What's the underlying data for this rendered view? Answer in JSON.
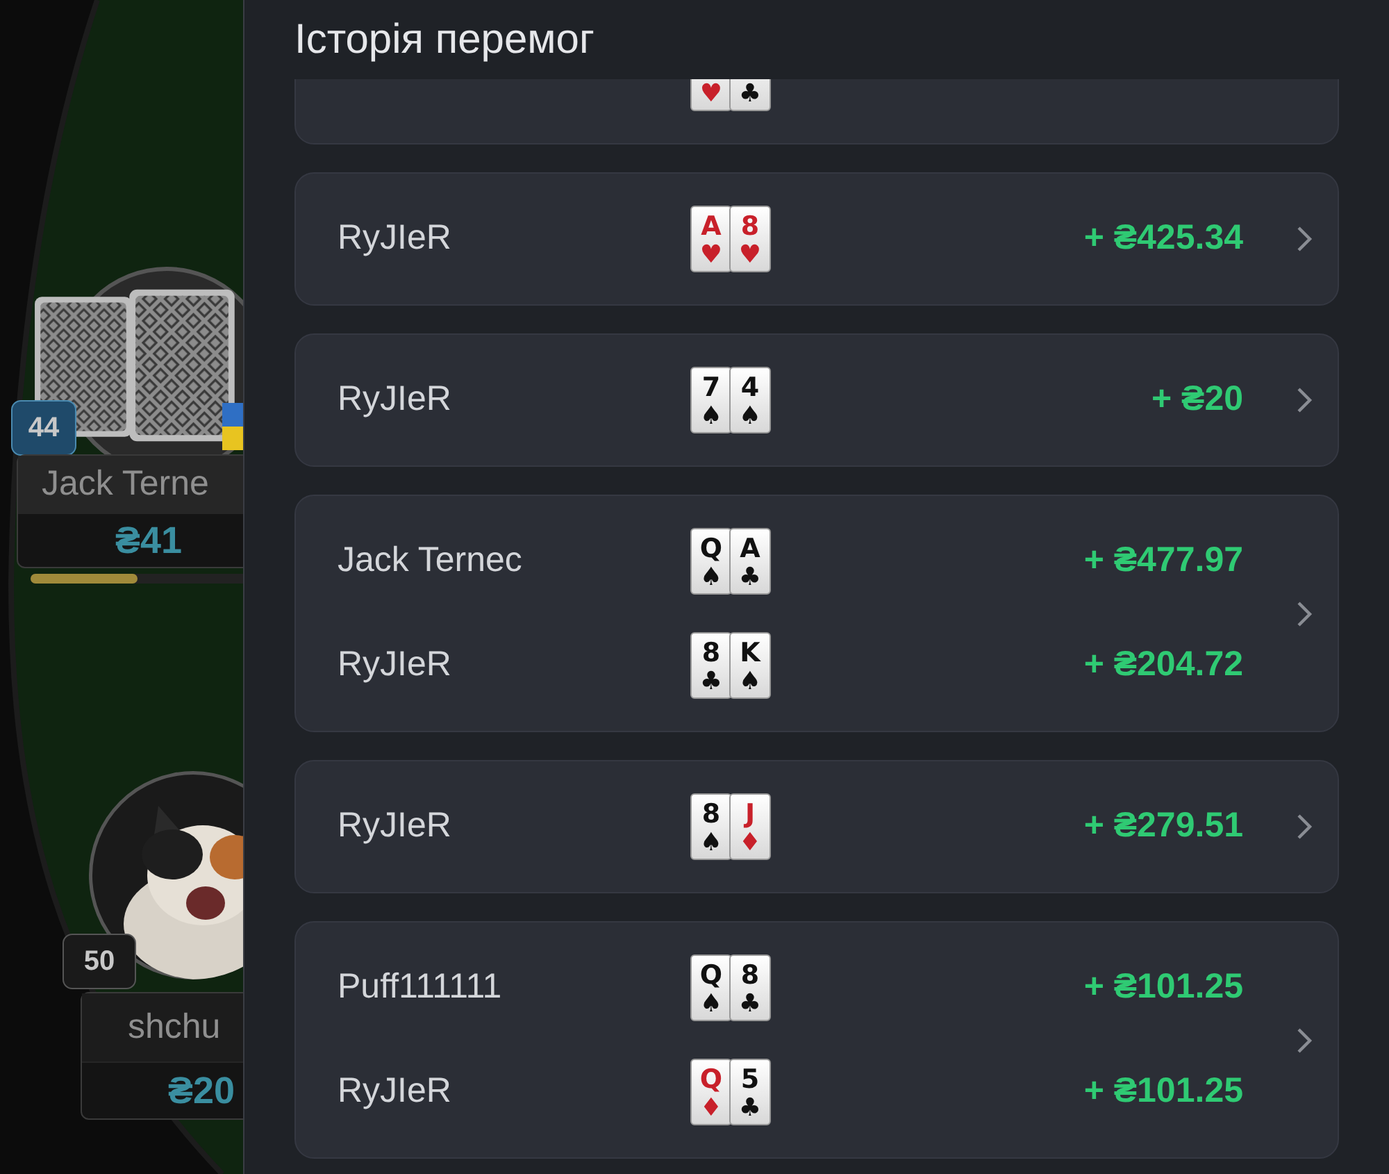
{
  "table": {
    "seats": [
      {
        "kind": "cards",
        "level_badge": "44",
        "name": "Jack Terne",
        "stack": "₴41",
        "timer": {
          "level": 0.48
        }
      },
      {
        "kind": "avatar",
        "level_badge": "50",
        "name": "shchu",
        "stack": "₴20"
      }
    ]
  },
  "panel": {
    "title": "Історія перемог",
    "wins": [
      {
        "partial": true,
        "players": [
          {
            "cards": [
              {
                "suit": "♥",
                "color": "#c8202a"
              },
              {
                "suit": "♣",
                "color": "#111111"
              }
            ]
          }
        ]
      },
      {
        "partial": false,
        "players": [
          {
            "name": "RyJIeR",
            "cards": [
              {
                "rank": "A",
                "suit": "♥",
                "color": "#c8202a"
              },
              {
                "rank": "8",
                "suit": "♥",
                "color": "#c8202a"
              }
            ],
            "amount": "+ ₴425.34"
          }
        ]
      },
      {
        "partial": false,
        "players": [
          {
            "name": "RyJIeR",
            "cards": [
              {
                "rank": "7",
                "suit": "♠",
                "color": "#111111"
              },
              {
                "rank": "4",
                "suit": "♠",
                "color": "#111111"
              }
            ],
            "amount": "+ ₴20"
          }
        ]
      },
      {
        "partial": false,
        "players": [
          {
            "name": "Jack Ternec",
            "cards": [
              {
                "rank": "Q",
                "suit": "♠",
                "color": "#111111"
              },
              {
                "rank": "A",
                "suit": "♣",
                "color": "#111111"
              }
            ],
            "amount": "+ ₴477.97"
          },
          {
            "name": "RyJIeR",
            "cards": [
              {
                "rank": "8",
                "suit": "♣",
                "color": "#111111"
              },
              {
                "rank": "K",
                "suit": "♠",
                "color": "#111111"
              }
            ],
            "amount": "+ ₴204.72"
          }
        ]
      },
      {
        "partial": false,
        "players": [
          {
            "name": "RyJIeR",
            "cards": [
              {
                "rank": "8",
                "suit": "♠",
                "color": "#111111"
              },
              {
                "rank": "J",
                "suit": "♦",
                "color": "#c8202a"
              }
            ],
            "amount": "+ ₴279.51"
          }
        ]
      },
      {
        "partial": false,
        "players": [
          {
            "name": "Puff111111",
            "cards": [
              {
                "rank": "Q",
                "suit": "♠",
                "color": "#111111"
              },
              {
                "rank": "8",
                "suit": "♣",
                "color": "#111111"
              }
            ],
            "amount": "+ ₴101.25"
          },
          {
            "name": "RyJIeR",
            "cards": [
              {
                "rank": "Q",
                "suit": "♦",
                "color": "#c8202a"
              },
              {
                "rank": "5",
                "suit": "♣",
                "color": "#111111"
              }
            ],
            "amount": "+ ₴101.25"
          }
        ]
      }
    ]
  }
}
